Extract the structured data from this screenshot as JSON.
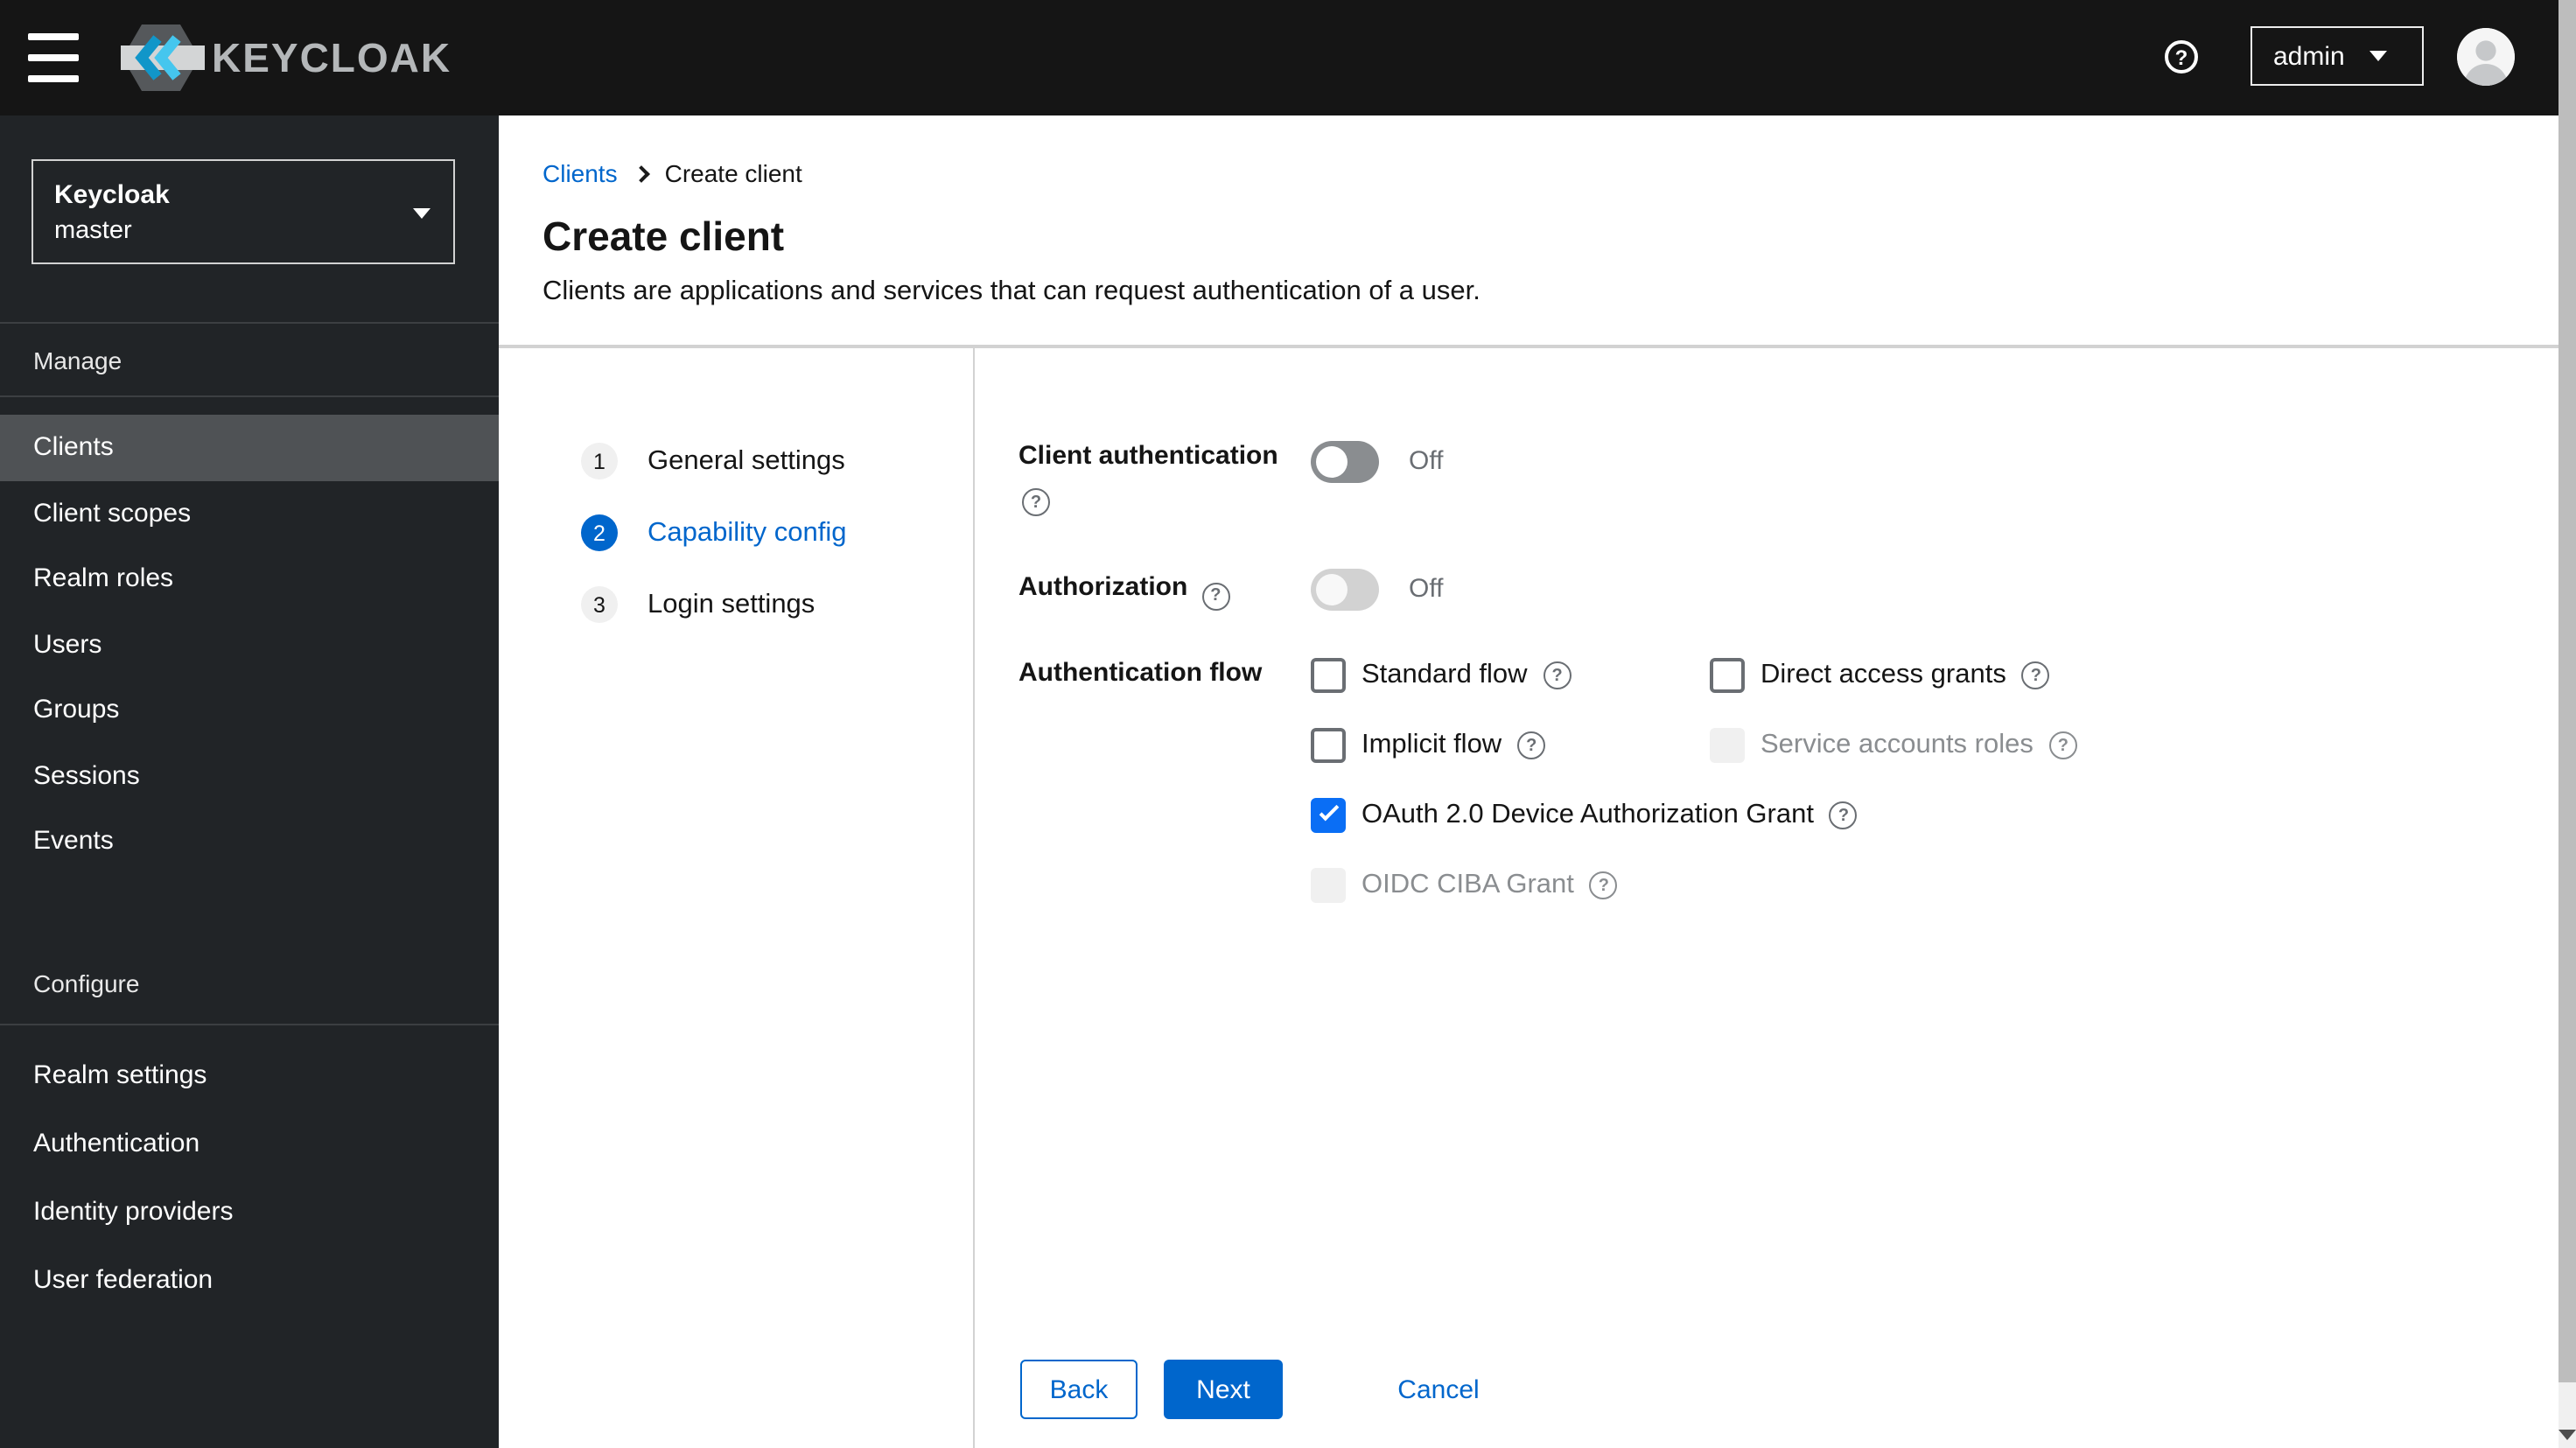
{
  "topbar": {
    "brand": "KEYCLOAK",
    "user": "admin"
  },
  "sidebar": {
    "realm_selector": {
      "name": "Keycloak",
      "realm": "master"
    },
    "sections": [
      {
        "label": "Manage",
        "items": [
          "Clients",
          "Client scopes",
          "Realm roles",
          "Users",
          "Groups",
          "Sessions",
          "Events"
        ]
      },
      {
        "label": "Configure",
        "items": [
          "Realm settings",
          "Authentication",
          "Identity providers",
          "User federation"
        ]
      }
    ],
    "active_item": "Clients"
  },
  "breadcrumb": {
    "parent": "Clients",
    "current": "Create client"
  },
  "header": {
    "title": "Create client",
    "subtitle": "Clients are applications and services that can request authentication of a user."
  },
  "wizard": {
    "active_step": "2",
    "steps": [
      {
        "number": "1",
        "label": "General settings"
      },
      {
        "number": "2",
        "label": "Capability config"
      },
      {
        "number": "3",
        "label": "Login settings"
      }
    ]
  },
  "form": {
    "client_authentication": {
      "label": "Client authentication",
      "value": "Off"
    },
    "authorization": {
      "label": "Authorization",
      "value": "Off"
    },
    "authentication_flow": {
      "label": "Authentication flow",
      "options": [
        {
          "label": "Standard flow",
          "checked": false,
          "disabled": false
        },
        {
          "label": "Direct access grants",
          "checked": false,
          "disabled": false
        },
        {
          "label": "Implicit flow",
          "checked": false,
          "disabled": false
        },
        {
          "label": "Service accounts roles",
          "checked": false,
          "disabled": true
        },
        {
          "label": "OAuth 2.0 Device Authorization Grant",
          "checked": true,
          "disabled": false
        },
        {
          "label": "OIDC CIBA Grant",
          "checked": false,
          "disabled": true
        }
      ]
    },
    "actions": {
      "back": "Back",
      "next": "Next",
      "cancel": "Cancel"
    }
  },
  "colors": {
    "primary": "#0066cc",
    "checkbox_checked": "#0a6ef5",
    "topbar_bg": "#151515",
    "sidebar_bg": "#212427",
    "sidebar_active_bg": "#4f5255",
    "divider": "#d2d2d2"
  }
}
